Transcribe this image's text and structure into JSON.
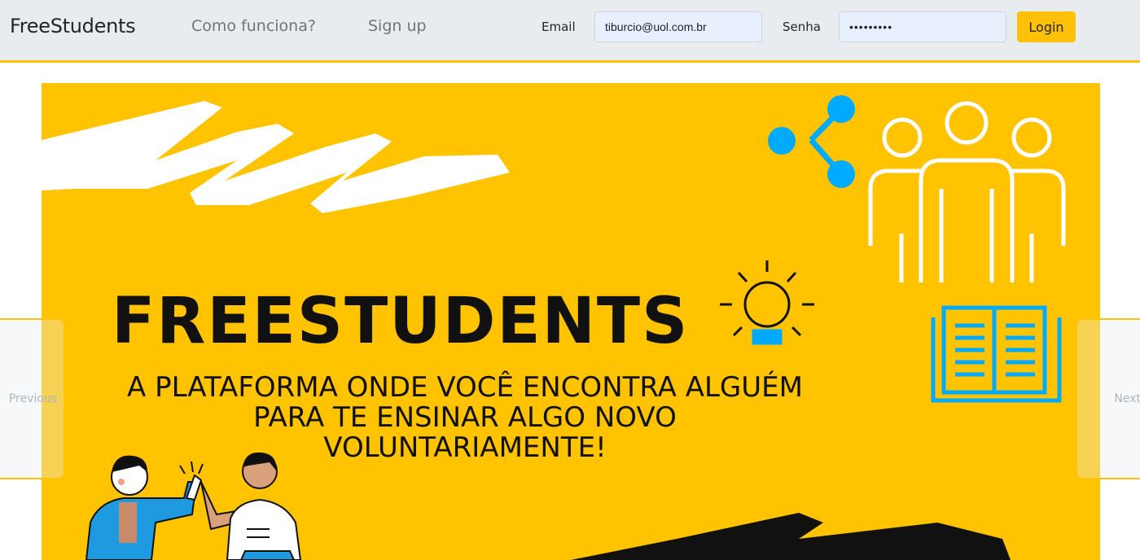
{
  "navbar": {
    "brand": "FreeStudents",
    "links": [
      {
        "label": "Como funciona?"
      },
      {
        "label": "Sign up"
      }
    ],
    "login_form": {
      "email_label": "Email",
      "email_value": "tiburcio@uol.com.br",
      "senha_label": "Senha",
      "senha_value": "•••••••••",
      "login_button": "Login"
    }
  },
  "carousel": {
    "slide": {
      "title": "FREESTUDENTS",
      "subtitle_line1": "A PLATAFORMA ONDE VOCÊ ENCONTRA ALGUÉM",
      "subtitle_line2": "PARA TE ENSINAR ALGO NOVO",
      "subtitle_line3": "VOLUNTARIAMENTE!",
      "background_color": "#ffc300",
      "icons": [
        "share-icon",
        "group-icon",
        "lightbulb-icon",
        "open-book-icon",
        "high-five-illustration"
      ]
    },
    "prev_label": "Previous",
    "next_label": "Next"
  },
  "colors": {
    "accent": "#ffc107",
    "navbar_bg": "#e9ecef",
    "icon_blue": "#00aaff"
  }
}
